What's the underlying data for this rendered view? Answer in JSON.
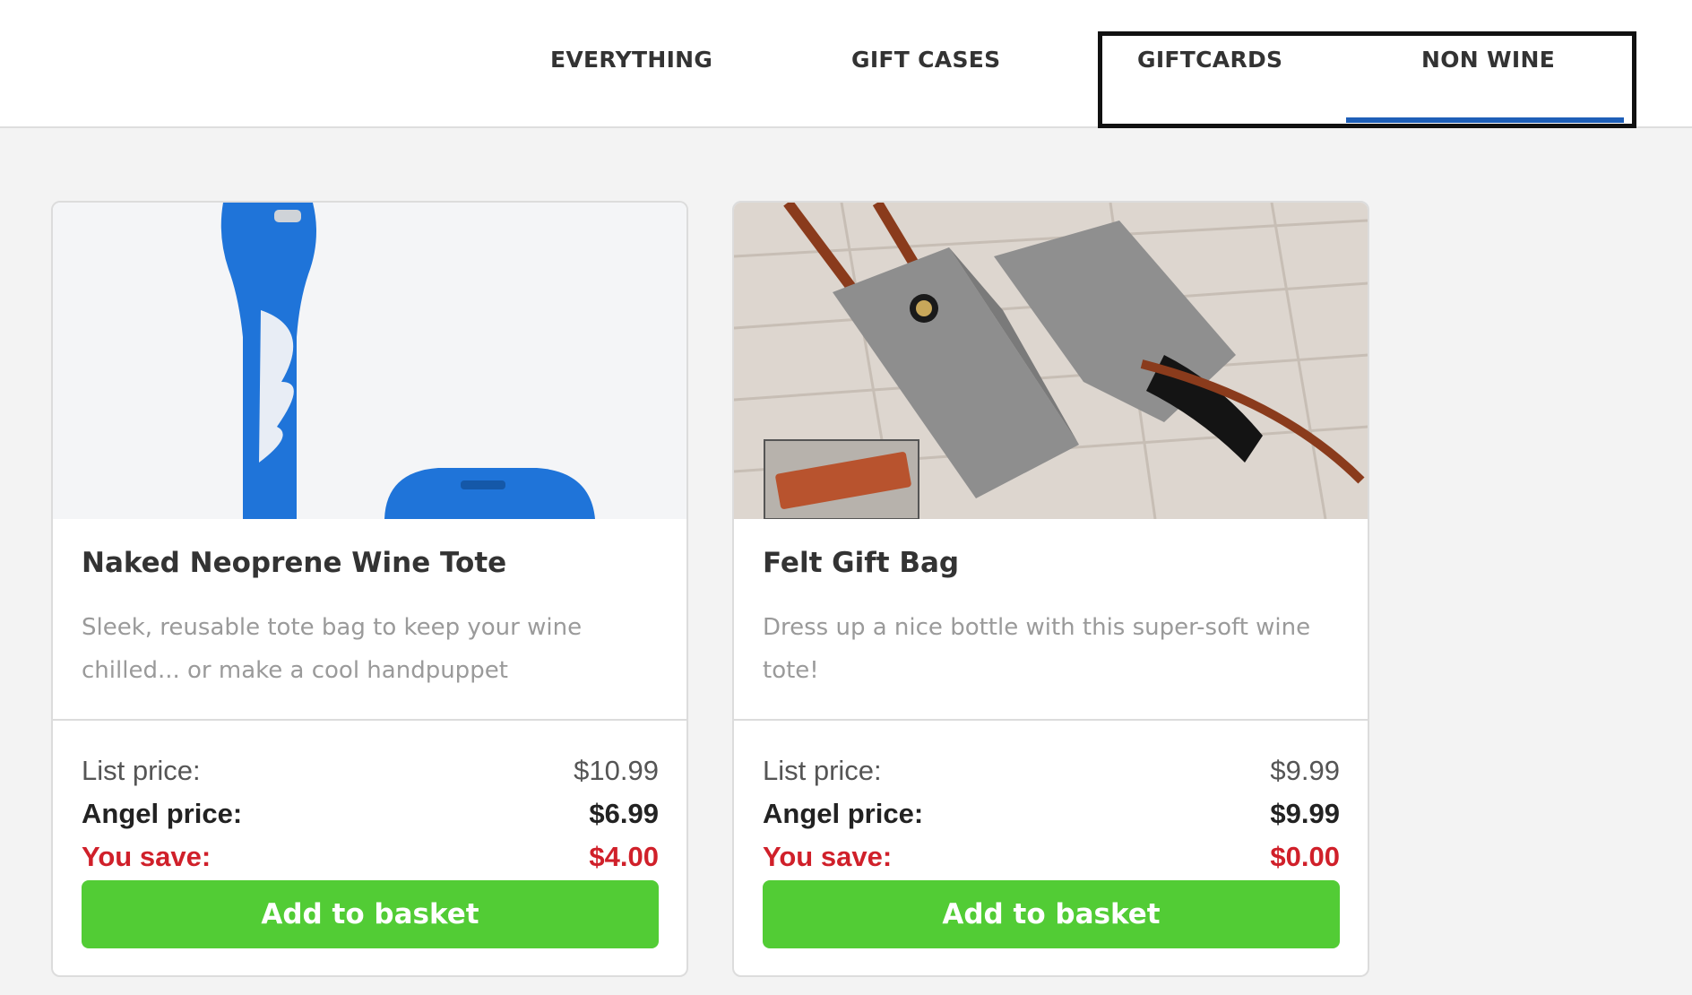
{
  "nav": {
    "tabs": [
      {
        "label": "EVERYTHING"
      },
      {
        "label": "GIFT CASES"
      },
      {
        "label": "GIFTCARDS"
      },
      {
        "label": "NON WINE"
      }
    ],
    "active_tab": "NON WINE",
    "accent_color": "#1e5fb8"
  },
  "products": [
    {
      "title": "Naked Neoprene Wine Tote",
      "description": "Sleek, reusable tote bag to keep your wine chilled... or make a cool handpuppet",
      "list_price_label": "List price:",
      "list_price": "$10.99",
      "angel_price_label": "Angel price:",
      "angel_price": "$6.99",
      "you_save_label": "You save:",
      "you_save": "$4.00",
      "button_label": "Add to basket"
    },
    {
      "title": "Felt Gift Bag",
      "description": "Dress up a nice bottle with this super-soft wine tote!",
      "list_price_label": "List price:",
      "list_price": "$9.99",
      "angel_price_label": "Angel price:",
      "angel_price": "$9.99",
      "you_save_label": "You save:",
      "you_save": "$0.00",
      "button_label": "Add to basket"
    }
  ],
  "colors": {
    "button": "#52cc35",
    "savings": "#d0202a"
  }
}
